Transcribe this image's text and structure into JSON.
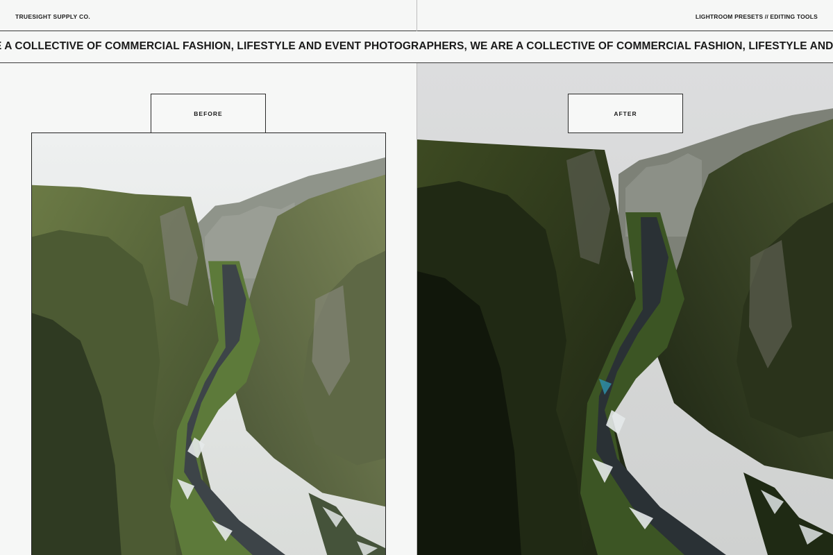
{
  "header": {
    "brand": "TRUESIGHT SUPPLY CO.",
    "tagline": "LIGHTROOM PRESETS // EDITING TOOLS"
  },
  "ticker": {
    "text": "E A COLLECTIVE OF COMMERCIAL FASHION, LIFESTYLE AND EVENT PHOTOGRAPHERS, WE ARE A COLLECTIVE OF COMMERCIAL FASHION, LIFESTYLE AND EVENT PHOTOGRAPHERS"
  },
  "panels": {
    "before": {
      "label": "BEFORE"
    },
    "after": {
      "label": "AFTER"
    }
  },
  "colors": {
    "background": "#f6f7f6",
    "line": "#2a2a2a",
    "text": "#1a1a1a"
  }
}
